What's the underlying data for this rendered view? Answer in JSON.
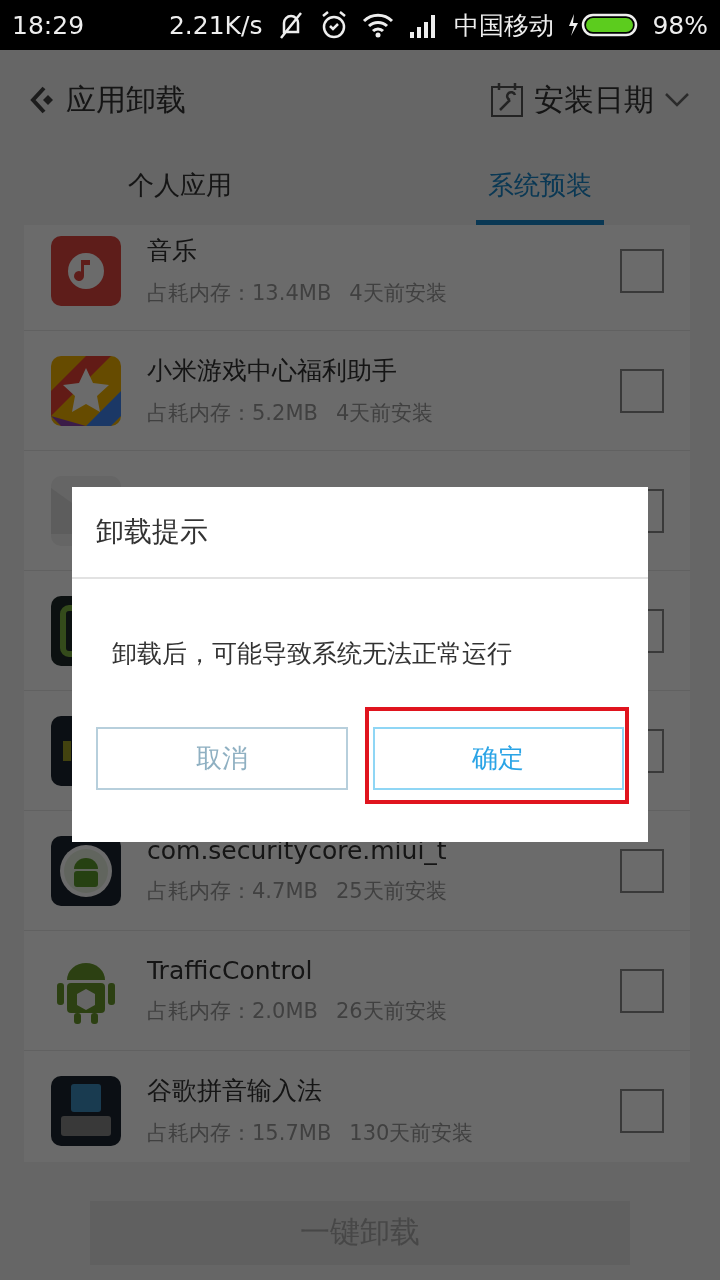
{
  "status_bar": {
    "time": "18:29",
    "net_speed": "2.21K/s",
    "carrier": "中国移动",
    "battery": "98%"
  },
  "header": {
    "back_title": "应用卸载",
    "sort_label": "安装日期"
  },
  "tabs": [
    {
      "label": "个人应用",
      "selected": false
    },
    {
      "label": "系统预装",
      "selected": true
    }
  ],
  "apps": [
    {
      "kind": "music",
      "name": "音乐",
      "size": "占耗内存：13.4MB",
      "installed": "4天前安装",
      "checked": false
    },
    {
      "kind": "star",
      "name": "小米游戏中心福利助手",
      "size": "占耗内存：5.2MB",
      "installed": "4天前安装",
      "checked": false
    },
    {
      "kind": "mail",
      "checked": false
    },
    {
      "kind": "frame",
      "checked": false
    },
    {
      "kind": "dark",
      "checked": false
    },
    {
      "kind": "android-ring",
      "name": "com.securitycore.miui_t",
      "size": "占耗内存：4.7MB",
      "installed": "25天前安装",
      "checked": false
    },
    {
      "kind": "android-box",
      "name": "TrafficControl",
      "size": "占耗内存：2.0MB",
      "installed": "26天前安装",
      "checked": false
    },
    {
      "kind": "keyboard",
      "name": "谷歌拼音输入法",
      "size": "占耗内存：15.7MB",
      "installed": "130天前安装",
      "checked": false
    }
  ],
  "bottom_button": {
    "label": "一键卸载",
    "disabled": true
  },
  "dialog": {
    "title": "卸载提示",
    "message": "卸载后，可能导致系统无法正常运行",
    "buttons": [
      {
        "kind": "cancel",
        "label": "取消",
        "highlighted": false
      },
      {
        "kind": "confirm",
        "label": "确定",
        "highlighted": true
      }
    ]
  }
}
